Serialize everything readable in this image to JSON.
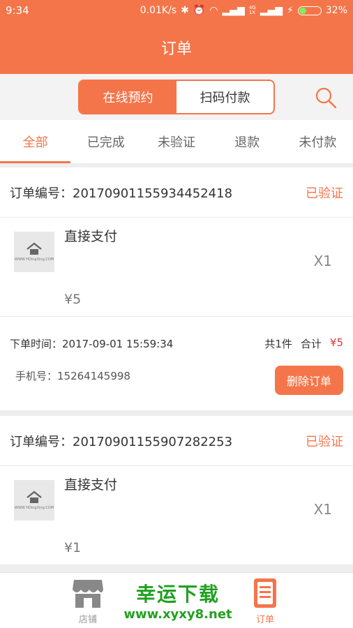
{
  "status_bar": {
    "time": "9:34",
    "network_speed": "0.01K/s",
    "network_type_top": "4G",
    "network_type_bottom": "1X",
    "battery": "32%",
    "battery_level": 0.32
  },
  "header": {
    "title": "订单"
  },
  "mode_toggle": {
    "online_label": "在线预约",
    "scan_label": "扫码付款"
  },
  "tabs": [
    {
      "label": "全部",
      "active": true
    },
    {
      "label": "已完成"
    },
    {
      "label": "未验证"
    },
    {
      "label": "退款"
    },
    {
      "label": "未付款"
    }
  ],
  "orders": [
    {
      "order_no": "订单编号：20170901155934452418",
      "status": "已验证",
      "item_name": "直接支付",
      "price": "¥5",
      "quantity": "X1",
      "time": "下单时间：2017-09-01 15:59:34",
      "count": "共1件",
      "total_label": "合计",
      "total": "¥5",
      "phone": "手机号：15264145998",
      "delete_label": "删除订单"
    },
    {
      "order_no": "订单编号：20170901155907282253",
      "status": "已验证",
      "item_name": "直接支付",
      "price": "¥1",
      "quantity": "X1"
    }
  ],
  "bottom_nav": {
    "store_label": "店铺",
    "orders_label": "订单"
  },
  "watermark": {
    "title": "幸运下载",
    "url": "www.xyxy8.net"
  },
  "colors": {
    "accent": "#f4754a",
    "price_red": "#e5342f",
    "watermark_green": "#21a121"
  }
}
